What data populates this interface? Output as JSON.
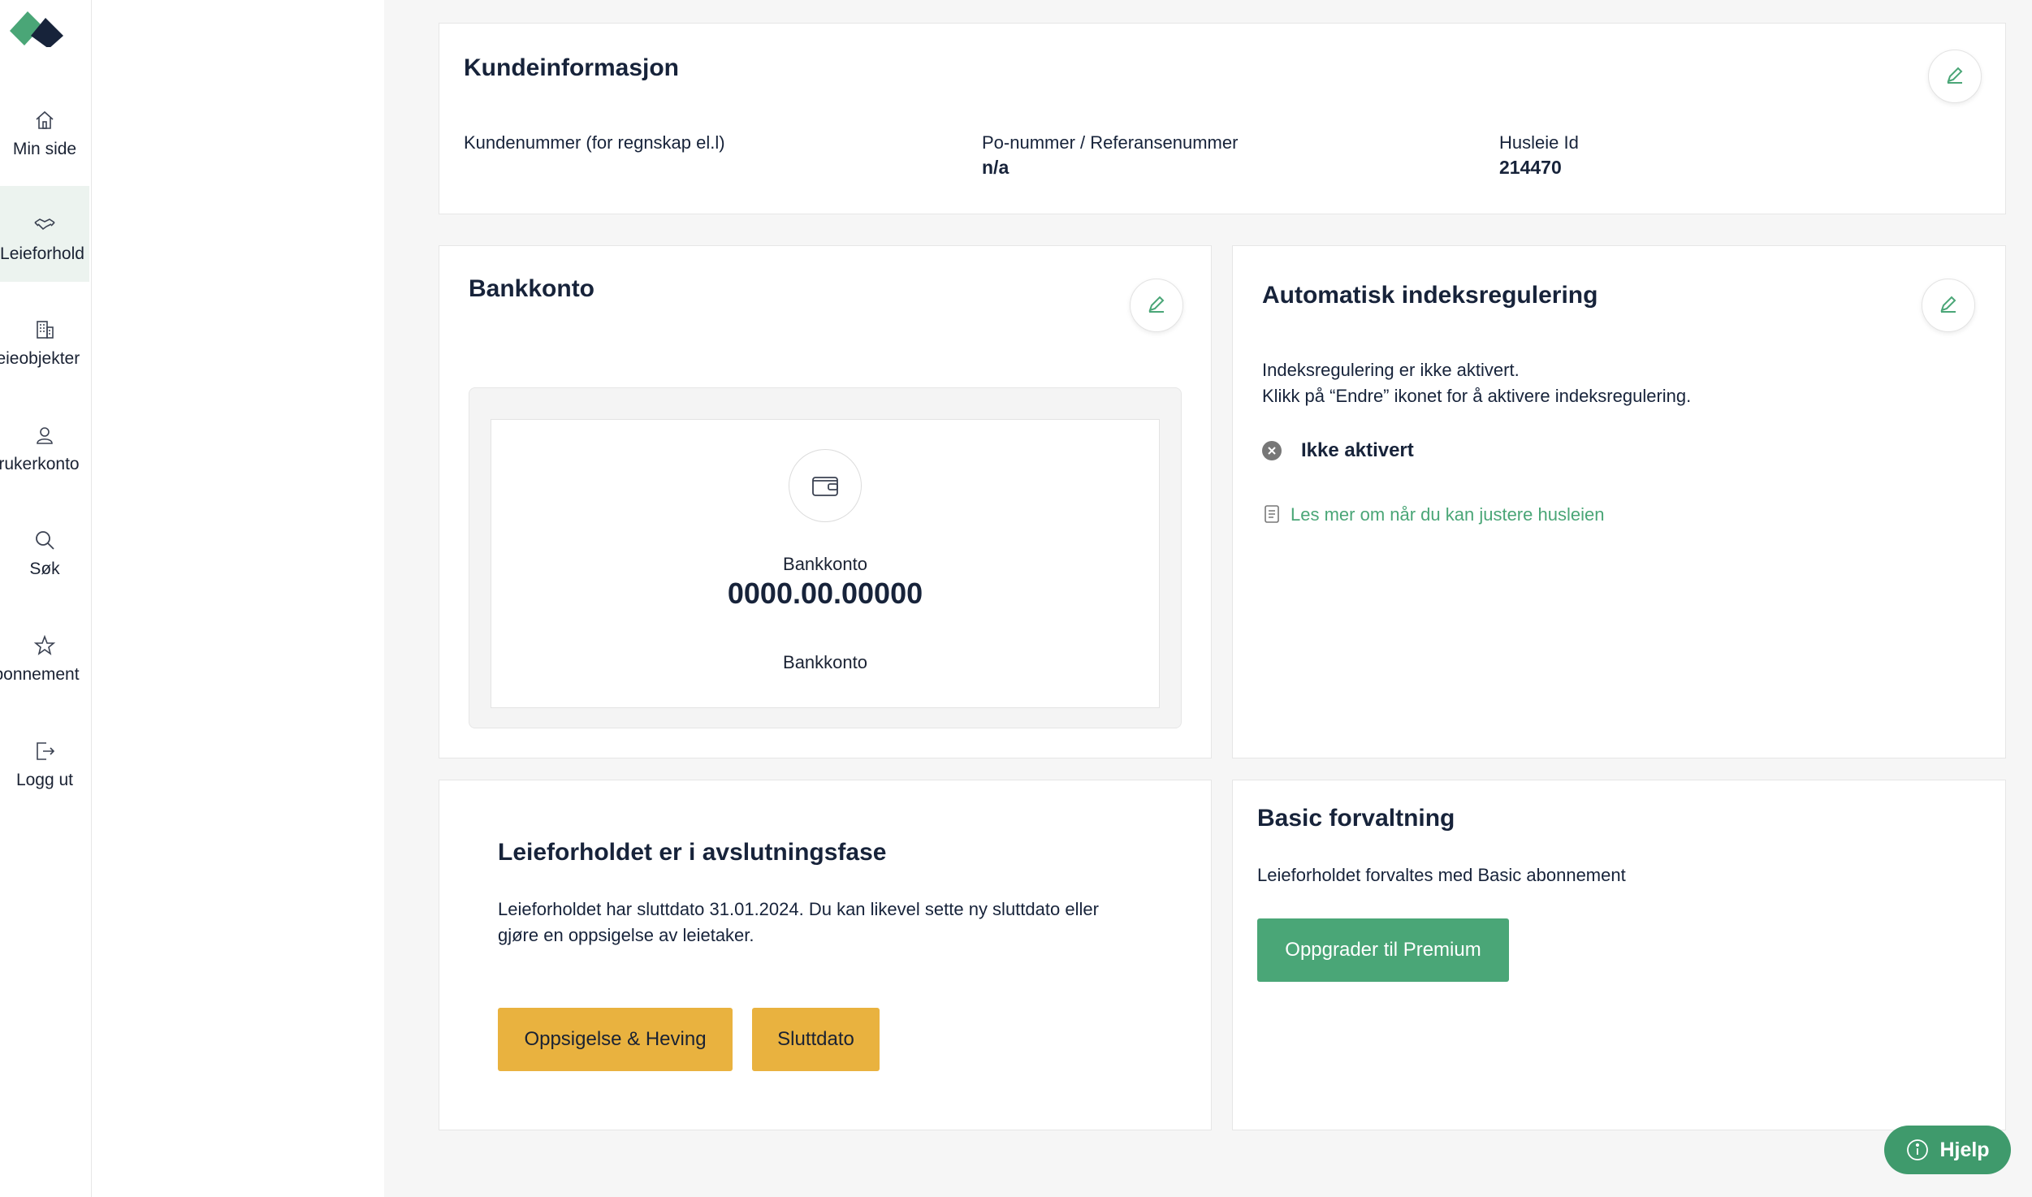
{
  "sidebar": {
    "items": [
      {
        "label": "Min side",
        "icon": "home-icon"
      },
      {
        "label": "Leieforhold",
        "icon": "handshake-icon"
      },
      {
        "label": "Leieobjekter",
        "icon": "building-icon"
      },
      {
        "label": "Brukerkonto",
        "icon": "user-icon"
      },
      {
        "label": "Søk",
        "icon": "search-icon"
      },
      {
        "label": "Abonnement",
        "icon": "star-icon"
      },
      {
        "label": "Logg ut",
        "icon": "logout-icon"
      }
    ]
  },
  "kundeinfo": {
    "title": "Kundeinformasjon",
    "kundenummer_label": "Kundenummer (for regnskap el.l)",
    "kundenummer_value": "",
    "po_label": "Po-nummer / Referansenummer",
    "po_value": "n/a",
    "husleie_label": "Husleie Id",
    "husleie_value": "214470"
  },
  "bankkonto": {
    "title": "Bankkonto",
    "label": "Bankkonto",
    "number": "0000.00.00000",
    "footer": "Bankkonto"
  },
  "indeks": {
    "title": "Automatisk indeksregulering",
    "line1": "Indeksregulering er ikke aktivert.",
    "line2": "Klikk på “Endre” ikonet for å aktivere indeksregulering.",
    "status": "Ikke aktivert",
    "link": "Les mer om når du kan justere husleien"
  },
  "avslutning": {
    "title": "Leieforholdet er i avslutningsfase",
    "line1": "Leieforholdet har sluttdato 31.01.2024. Du kan likevel sette ny sluttdato eller",
    "line2": "gjøre en oppsigelse av leietaker.",
    "btn1": "Oppsigelse & Heving",
    "btn2": "Sluttdato"
  },
  "forvaltning": {
    "title": "Basic forvaltning",
    "text": "Leieforholdet forvaltes med Basic abonnement",
    "btn": "Oppgrader til Premium"
  },
  "help": {
    "label": "Hjelp"
  },
  "colors": {
    "accent": "#4aa677",
    "warning": "#e9b23f",
    "navy": "#17233a"
  }
}
